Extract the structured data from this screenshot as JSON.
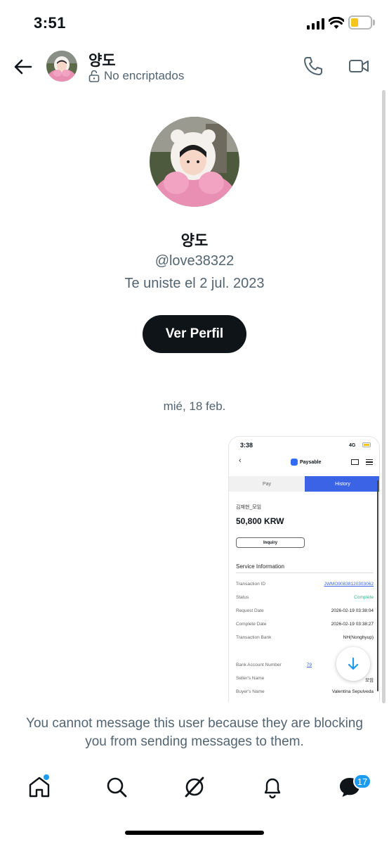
{
  "status_bar": {
    "time": "3:51"
  },
  "header": {
    "name": "양도",
    "encryption_status": "No encriptados"
  },
  "profile": {
    "name": "양도",
    "handle": "@love38322",
    "joined": "Te uniste el 2 jul. 2023",
    "view_profile_label": "Ver Perfil"
  },
  "conversation": {
    "date_separator": "mié, 18 feb."
  },
  "attachment": {
    "time": "3:38",
    "network": "4G",
    "app_name": "Paysable",
    "tabs": [
      "Pay",
      "History"
    ],
    "active_tab": "History",
    "merchant": "김재현_모임",
    "amount": "50,800 KRW",
    "inquiry_label": "Inquiry",
    "section_title": "Service Information",
    "rows": [
      {
        "key": "Transaction ID",
        "value": "JWMO90838120303062"
      },
      {
        "key": "Status",
        "value": "Complete"
      },
      {
        "key": "Request Date",
        "value": "2026-02-19 03:38:04"
      },
      {
        "key": "Complete Date",
        "value": "2026-02-19 03:38:27"
      },
      {
        "key": "Transaction Bank",
        "value": "NH(Nonghyup)"
      },
      {
        "key": "Bank Account Number",
        "value": "79"
      },
      {
        "key": "Seller's Name",
        "value": "모임"
      },
      {
        "key": "Buyer's Name",
        "value": "Valentina Sepulveda"
      }
    ]
  },
  "blocked_message": "You cannot message this user because they are blocking you from sending messages to them.",
  "nav": {
    "messages_badge": "17"
  },
  "colors": {
    "accent": "#1d9bf0",
    "button_dark": "#0f1419",
    "secondary_text": "#536471",
    "paysable_blue": "#3b63e6",
    "status_green": "#2bb58a"
  }
}
